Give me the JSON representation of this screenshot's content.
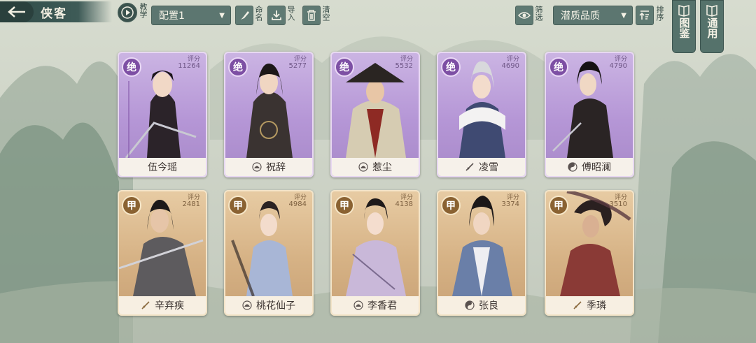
{
  "header": {
    "title": "侠客",
    "tutorial_label": "教学",
    "config_select": "配置1",
    "rename_label": "命名",
    "import_label": "导入",
    "clear_label": "清空",
    "filter_label": "筛选",
    "sort_select": "潜质品质",
    "sort_label": "排序"
  },
  "side_tabs": [
    {
      "label": "图鉴"
    },
    {
      "label": "通用"
    }
  ],
  "cards_row1": [
    {
      "grade": "绝",
      "score_label": "评分",
      "score": "11264",
      "name": "伍今瑶",
      "school_icon": "none"
    },
    {
      "grade": "绝",
      "score_label": "评分",
      "score": "5277",
      "name": "祝辞",
      "school_icon": "lotus-icon"
    },
    {
      "grade": "绝",
      "score_label": "评分",
      "score": "5532",
      "name": "惹尘",
      "school_icon": "lotus-icon"
    },
    {
      "grade": "绝",
      "score_label": "评分",
      "score": "4690",
      "name": "凌雪",
      "school_icon": "sword-icon"
    },
    {
      "grade": "绝",
      "score_label": "评分",
      "score": "4790",
      "name": "傅昭澜",
      "school_icon": "taiji-icon"
    }
  ],
  "cards_row2": [
    {
      "grade": "甲",
      "score_label": "评分",
      "score": "2481",
      "name": "辛弃疾",
      "school_icon": "sword-icon"
    },
    {
      "grade": "甲",
      "score_label": "评分",
      "score": "4984",
      "name": "桃花仙子",
      "school_icon": "lotus-icon"
    },
    {
      "grade": "甲",
      "score_label": "评分",
      "score": "4138",
      "name": "李香君",
      "school_icon": "lotus-icon"
    },
    {
      "grade": "甲",
      "score_label": "评分",
      "score": "3374",
      "name": "张良",
      "school_icon": "taiji-icon"
    },
    {
      "grade": "甲",
      "score_label": "评分",
      "score": "3510",
      "name": "季璘",
      "school_icon": "sword-icon"
    }
  ],
  "colors": {
    "jue_card": "#b596d6",
    "jia_card": "#d6b285",
    "toolbar": "#5c7670"
  }
}
